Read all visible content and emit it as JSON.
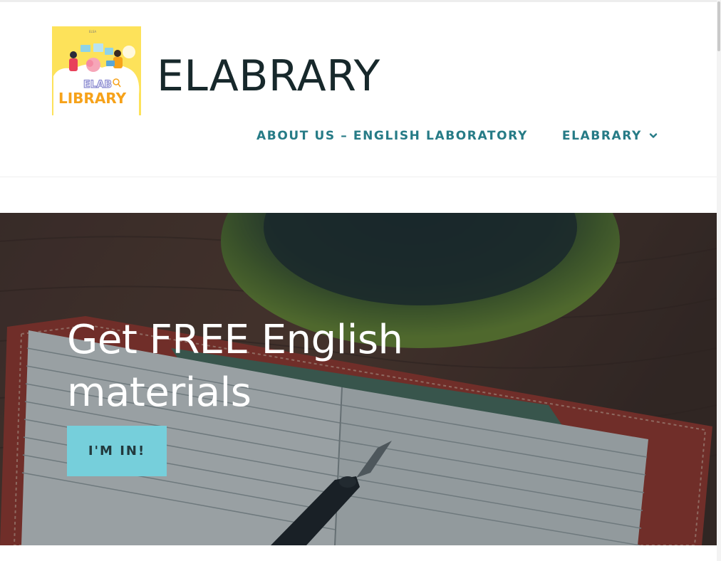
{
  "site": {
    "title": "ELABRARY",
    "logo": {
      "top_text": "ELAB",
      "main_text": "LIBRARY",
      "colors": {
        "background": "#fde25a",
        "text": "#f6a21a"
      }
    }
  },
  "nav": {
    "items": [
      {
        "label": "ABOUT US – ENGLISH LABORATORY"
      },
      {
        "label": "ELABRARY",
        "has_dropdown": true,
        "icon": "chevron-down-icon"
      }
    ],
    "color": "#267b86"
  },
  "hero": {
    "heading": "Get FREE English materials",
    "button_label": "I'M IN!",
    "button_color": "#76cfdb"
  }
}
